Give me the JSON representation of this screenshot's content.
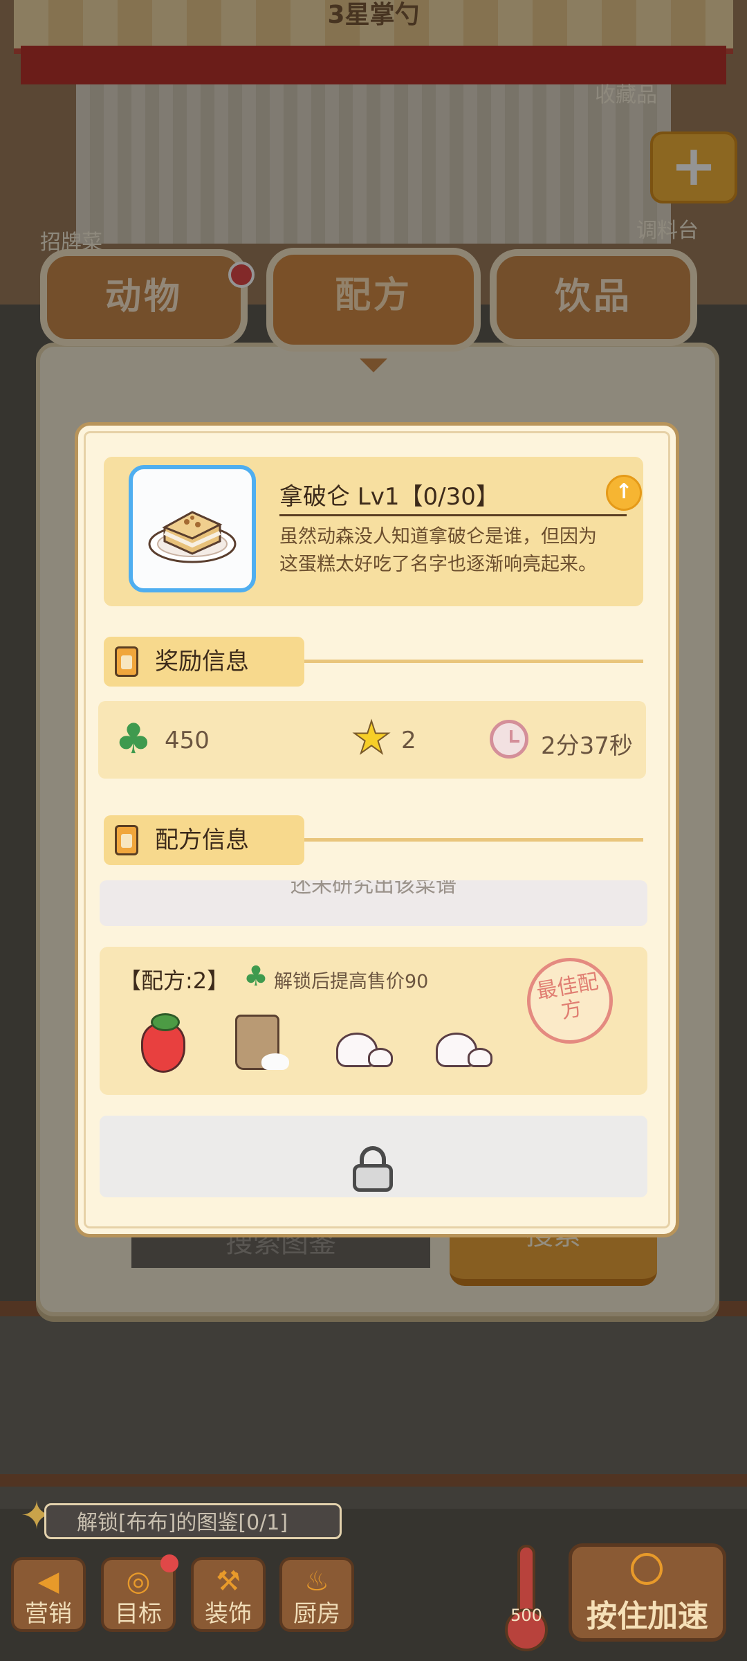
{
  "background": {
    "roof_title": "3星掌勺",
    "signature_dish_label": "招牌菜",
    "collection_label": "收藏品",
    "seasoning_label": "调料台",
    "panel_search_placeholder": "搜索图鉴",
    "panel_search_button": "搜索"
  },
  "tabs": [
    {
      "label": "动物",
      "has_badge": true
    },
    {
      "label": "配方",
      "selected": true
    },
    {
      "label": "饮品"
    }
  ],
  "dialog": {
    "dish": {
      "title": "拿破仑 Lv1【0/30】",
      "description": "虽然动森没人知道拿破仑是谁，但因为这蛋糕太好吃了名字也逐渐响亮起来。",
      "icon": "napoleon-cake-icon"
    },
    "rewards": {
      "heading": "奖励信息",
      "clover_value": "450",
      "star_value": "2",
      "time_value": "2分37秒"
    },
    "recipe": {
      "heading": "配方信息",
      "research_hint": "还未研究出该菜谱",
      "best_label": "【配方:2】",
      "best_unlock_text": "解锁后提高售价90",
      "stamp_text": "最佳配方",
      "ingredients": [
        "strawberry",
        "flour",
        "cream",
        "cream"
      ]
    }
  },
  "bottom": {
    "quest_text": "解锁[布布]的图鉴[0/1]",
    "buttons": [
      "营销",
      "目标",
      "装饰",
      "厨房"
    ],
    "thermometer_value": "500",
    "speed_button": "按住加速"
  },
  "colors": {
    "accent_orange": "#d28b46",
    "card_yellow": "#f7dfa0",
    "clover_green": "#3f9a4e",
    "badge_red": "#e04848"
  }
}
